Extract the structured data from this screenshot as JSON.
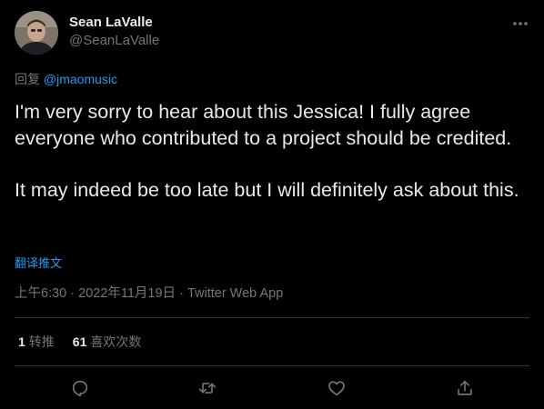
{
  "author": {
    "name": "Sean LaValle",
    "handle": "@SeanLaValle"
  },
  "reply": {
    "prefix": "回复",
    "mention": "@jmaomusic"
  },
  "tweet": {
    "paragraph1": "I'm very sorry to hear about this Jessica! I fully agree everyone who contributed to a project should be credited.",
    "paragraph2": "It may indeed be too late but I will definitely ask about this."
  },
  "translate_label": "翻译推文",
  "meta": {
    "time": "上午6:30",
    "separator": " · ",
    "date": "2022年11月19日",
    "source": "Twitter Web App"
  },
  "stats": {
    "retweets_count": "1",
    "retweets_label": "转推",
    "likes_count": "61",
    "likes_label": "喜欢次数"
  },
  "colors": {
    "background": "#000000",
    "text": "#e7e9ea",
    "secondary": "#71767b",
    "accent": "#1d9bf0",
    "divider": "#2f3336"
  },
  "icons": [
    "more-icon",
    "reply-icon",
    "retweet-icon",
    "like-icon",
    "share-icon"
  ]
}
